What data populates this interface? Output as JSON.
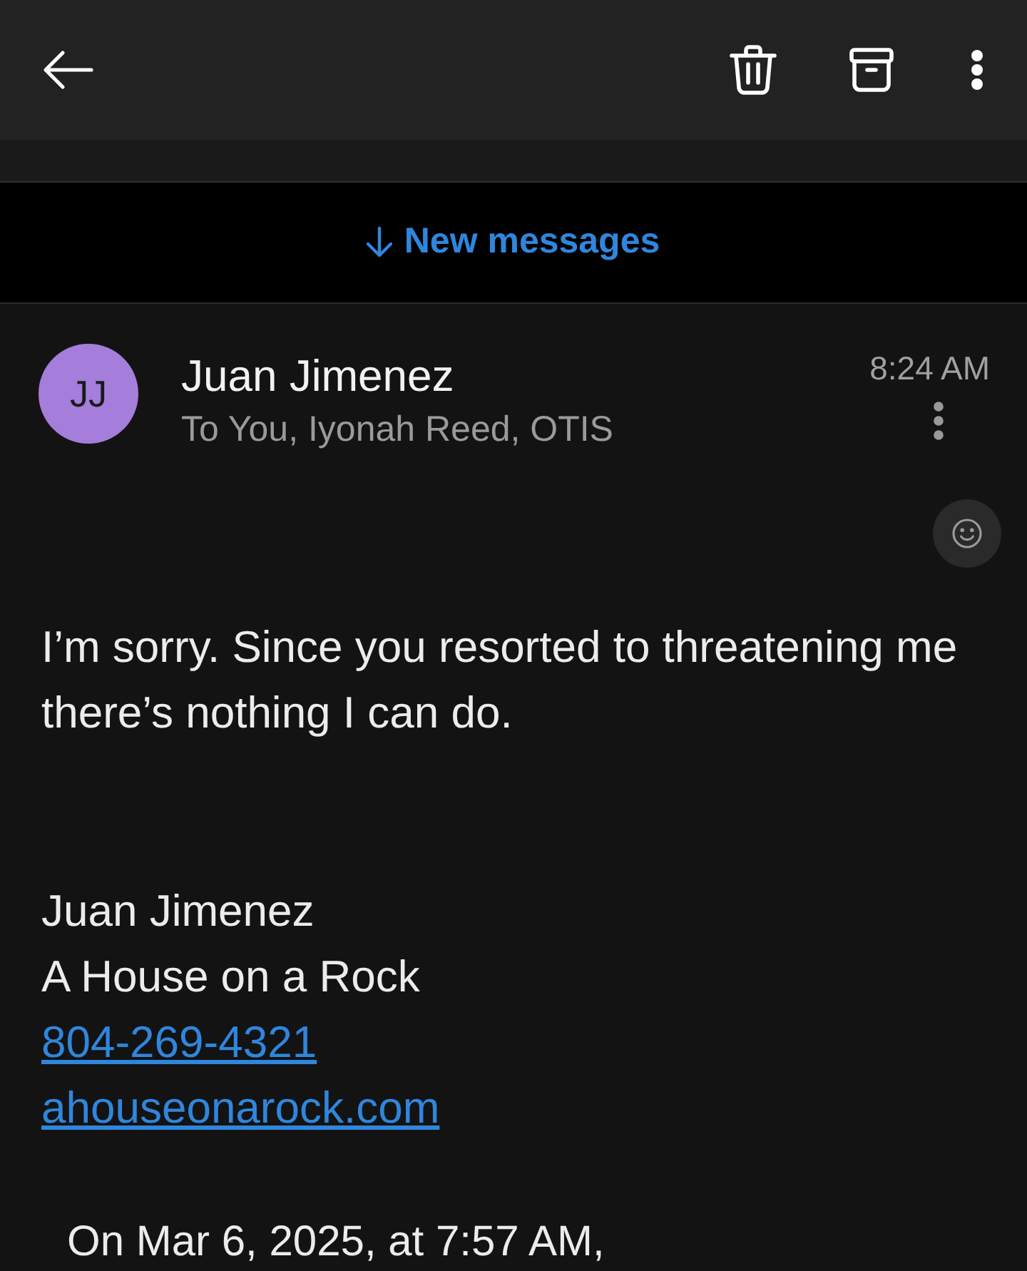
{
  "banner": {
    "text": "New messages"
  },
  "message": {
    "sender": {
      "initials": "JJ",
      "name": "Juan Jimenez"
    },
    "recipients": "To You, Iyonah Reed, OTIS",
    "time": "8:24 AM",
    "body": [
      "I’m sorry. Since you resorted to threatening me there’s nothing I can do."
    ],
    "signature": [
      {
        "kind": "text",
        "text": "Juan Jimenez"
      },
      {
        "kind": "text",
        "text": "A House on a Rock"
      },
      {
        "kind": "link",
        "text": "804-269-4321"
      },
      {
        "kind": "link",
        "text": "ahouseonarock.com"
      }
    ],
    "quote_header": "On Mar 6, 2025, at 7:57 AM,"
  }
}
